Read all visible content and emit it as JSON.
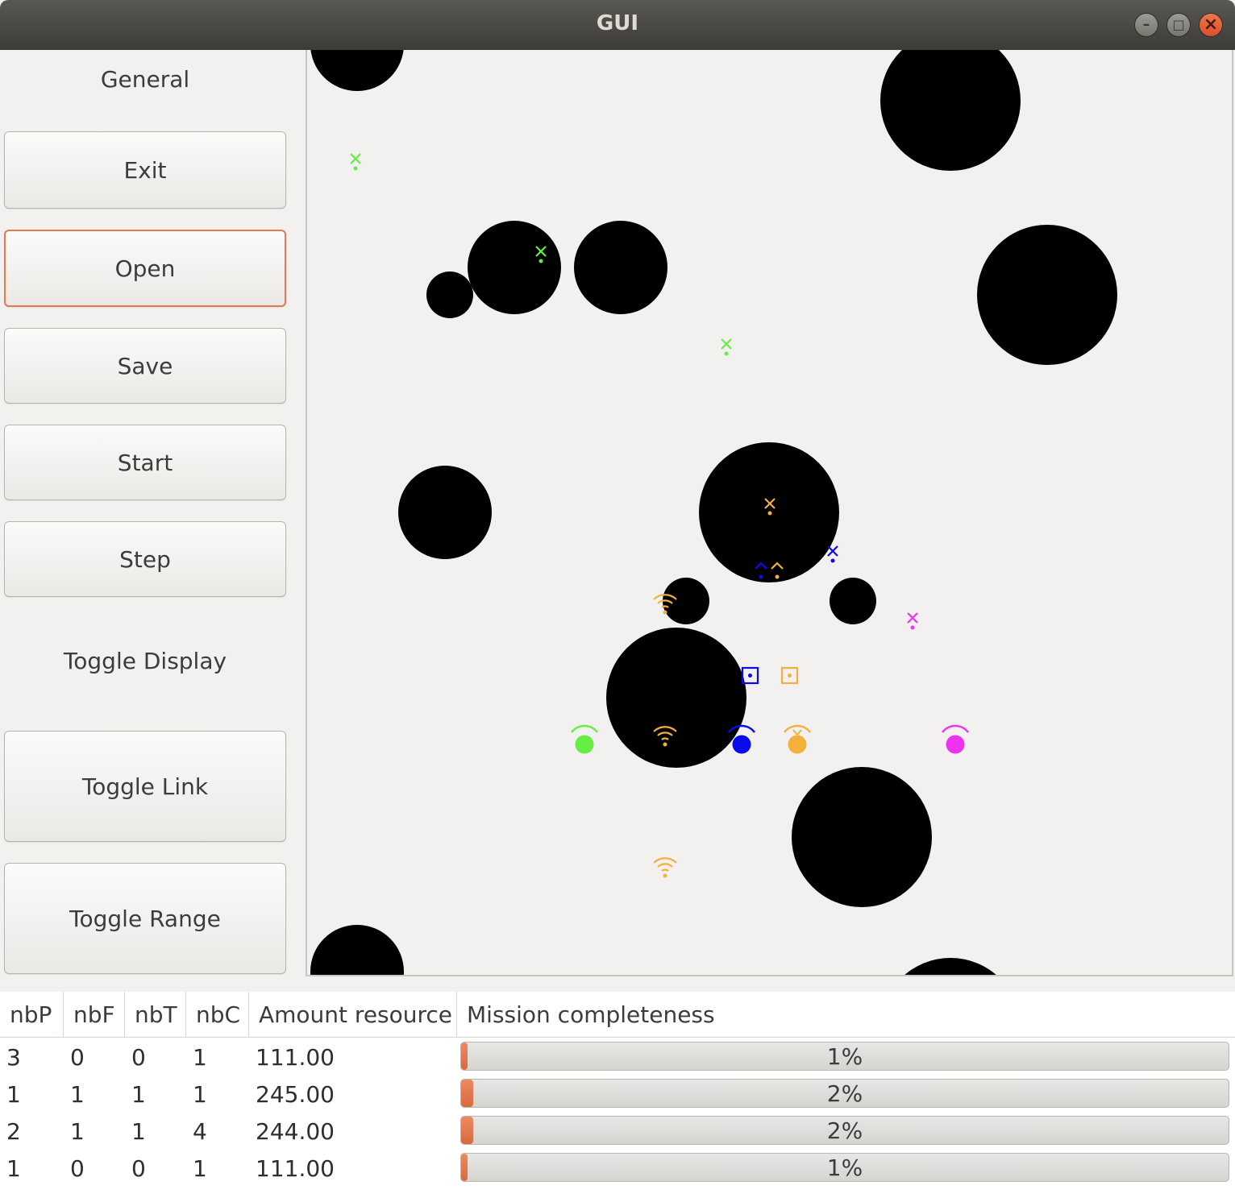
{
  "window": {
    "title": "GUI",
    "minimize_glyph": "–",
    "maximize_glyph": "□",
    "close_glyph": "×"
  },
  "sidebar": {
    "general_label": "General",
    "buttons": {
      "exit": "Exit",
      "open": "Open",
      "save": "Save",
      "start": "Start",
      "step": "Step"
    },
    "toggle_display_label": "Toggle Display",
    "toggle_buttons": {
      "link": "Toggle Link",
      "range": "Toggle Range"
    }
  },
  "colors": {
    "green": "#66ee44",
    "orange": "#f5b03c",
    "blue": "#0a0aee",
    "magenta": "#ee33ee",
    "obstacle": "#000000",
    "accent": "#e07a52"
  },
  "table": {
    "headers": [
      "nbP",
      "nbF",
      "nbT",
      "nbC",
      "Amount resource",
      "Mission completeness"
    ],
    "rows": [
      {
        "nbP": "3",
        "nbF": "0",
        "nbT": "0",
        "nbC": "1",
        "amount": "111.00",
        "completeness": 1,
        "completeness_label": "1%"
      },
      {
        "nbP": "1",
        "nbF": "1",
        "nbT": "1",
        "nbC": "1",
        "amount": "245.00",
        "completeness": 2,
        "completeness_label": "2%"
      },
      {
        "nbP": "2",
        "nbF": "1",
        "nbT": "1",
        "nbC": "4",
        "amount": "244.00",
        "completeness": 2,
        "completeness_label": "2%"
      },
      {
        "nbP": "1",
        "nbF": "0",
        "nbT": "0",
        "nbC": "1",
        "amount": "111.00",
        "completeness": 1,
        "completeness_label": "1%"
      }
    ]
  }
}
